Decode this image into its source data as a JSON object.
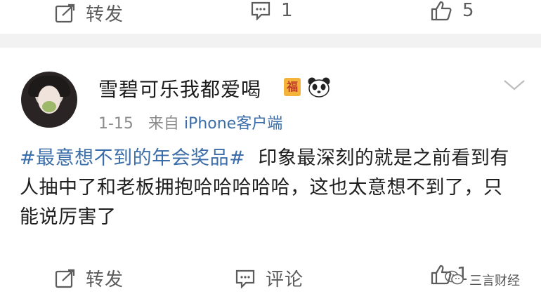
{
  "top_actions": {
    "repost_label": "转发",
    "comment_count": "1",
    "like_count": "5"
  },
  "post": {
    "username": "雪碧可乐我都爱喝",
    "badge_text": "福",
    "date": "1-15",
    "source_prefix": "来自",
    "source_name": "iPhone客户端",
    "hashtag": "#最意想不到的年会奖品#",
    "text": "印象最深刻的就是之前看到有人抽中了和老板拥抱哈哈哈哈哈，这也太意想不到了，只能说厉害了"
  },
  "bottom_actions": {
    "repost_label": "转发",
    "comment_label": "评论",
    "like_count": "1"
  },
  "watermark": {
    "text": "三言财经"
  },
  "colors": {
    "link": "#3b6ea8",
    "meta": "#8c8c8c",
    "separator": "#f2f2f2"
  }
}
